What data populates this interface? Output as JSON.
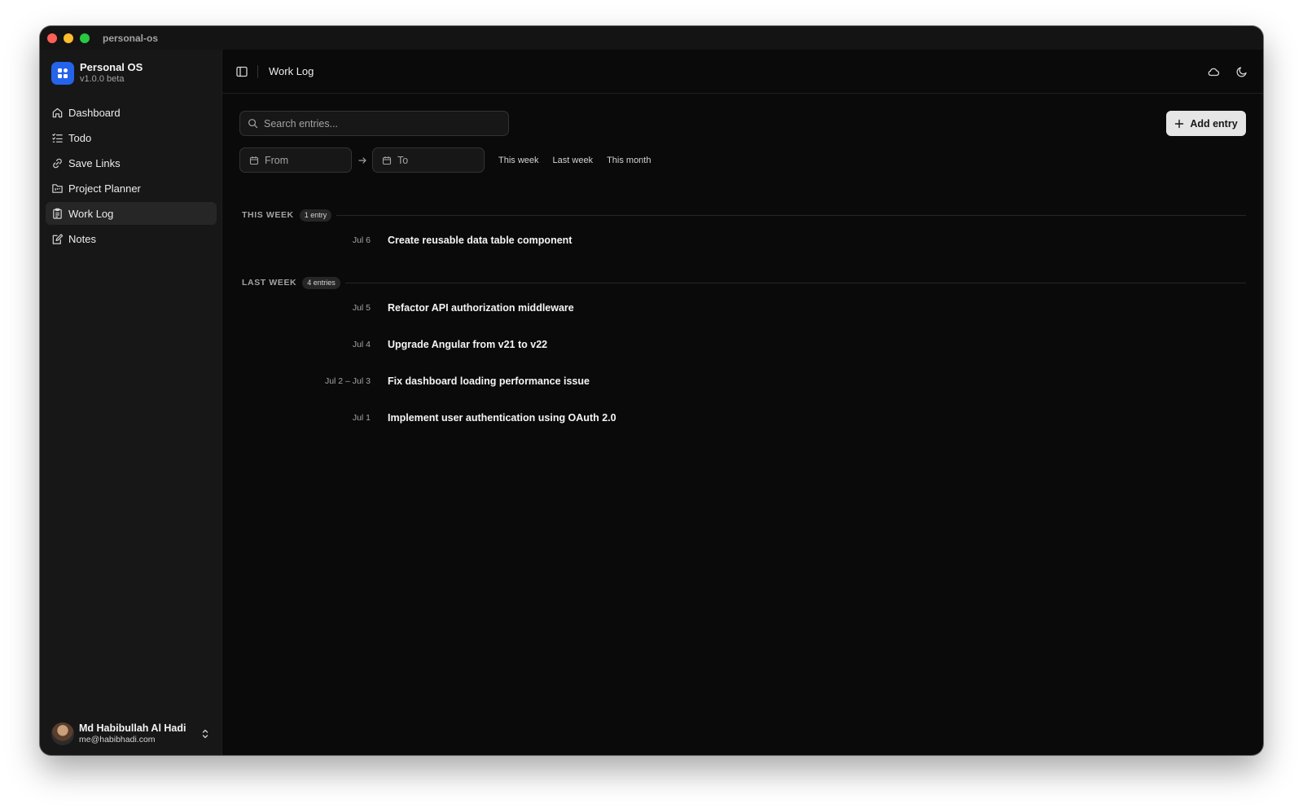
{
  "window": {
    "title": "personal-os"
  },
  "brand": {
    "name": "Personal OS",
    "version": "v1.0.0 beta"
  },
  "nav": [
    {
      "label": "Dashboard",
      "icon": "home-icon",
      "active": false
    },
    {
      "label": "Todo",
      "icon": "list-checks-icon",
      "active": false
    },
    {
      "label": "Save Links",
      "icon": "link-icon",
      "active": false
    },
    {
      "label": "Project Planner",
      "icon": "folder-kanban-icon",
      "active": false
    },
    {
      "label": "Work Log",
      "icon": "clipboard-list-icon",
      "active": true
    },
    {
      "label": "Notes",
      "icon": "note-edit-icon",
      "active": false
    }
  ],
  "user": {
    "name": "Md Habibullah Al Hadi",
    "email": "me@habibhadi.com"
  },
  "header": {
    "title": "Work Log"
  },
  "search": {
    "placeholder": "Search entries..."
  },
  "toolbar": {
    "add_label": "Add entry"
  },
  "date_range": {
    "from_placeholder": "From",
    "to_placeholder": "To"
  },
  "presets": [
    "This week",
    "Last week",
    "This month"
  ],
  "sections": [
    {
      "label": "THIS WEEK",
      "badge": "1 entry",
      "entries": [
        {
          "date": "Jul 6",
          "title": "Create reusable data table component"
        }
      ]
    },
    {
      "label": "LAST WEEK",
      "badge": "4 entries",
      "entries": [
        {
          "date": "Jul 5",
          "title": "Refactor API authorization middleware"
        },
        {
          "date": "Jul 4",
          "title": "Upgrade Angular from v21 to v22"
        },
        {
          "date": "Jul 2 – Jul 3",
          "title": "Fix dashboard loading performance issue"
        },
        {
          "date": "Jul 1",
          "title": "Implement user authentication using OAuth 2.0"
        }
      ]
    }
  ],
  "colors": {
    "accent": "#2563eb",
    "background": "#0a0a0a",
    "sidebar": "#171717"
  }
}
